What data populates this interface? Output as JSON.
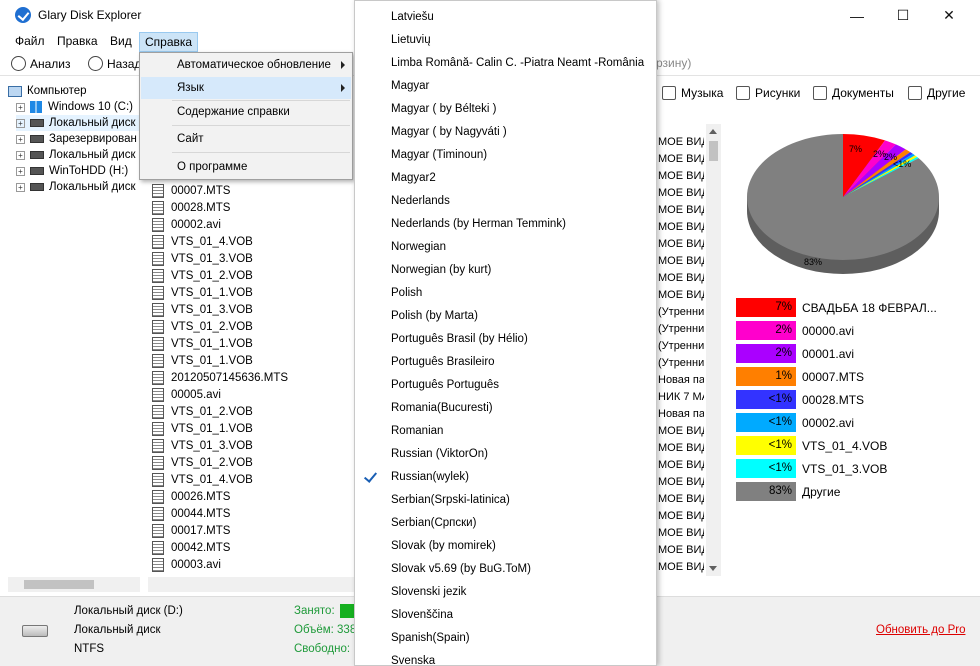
{
  "window": {
    "title": "Glary Disk Explorer",
    "min": "—",
    "max": "☐",
    "close": "✕"
  },
  "menubar": [
    "Файл",
    "Правка",
    "Вид",
    "Справка"
  ],
  "toolbar": {
    "analyze": "Анализ",
    "back": "Назад",
    "recycle_partial": "рзину)"
  },
  "tree": {
    "root": "Компьютер",
    "items": [
      "Windows 10 (C:)",
      "Локальный диск",
      "Зарезервирован",
      "Локальный диск",
      "WinToHDD (H:)",
      "Локальный диск"
    ]
  },
  "files": [
    "00007.MTS",
    "00028.MTS",
    "00002.avi",
    "VTS_01_4.VOB",
    "VTS_01_3.VOB",
    "VTS_01_2.VOB",
    "VTS_01_1.VOB",
    "VTS_01_3.VOB",
    "VTS_01_2.VOB",
    "VTS_01_1.VOB",
    "VTS_01_1.VOB",
    "20120507145636.MTS",
    "00005.avi",
    "VTS_01_2.VOB",
    "VTS_01_1.VOB",
    "VTS_01_3.VOB",
    "VTS_01_2.VOB",
    "VTS_01_4.VOB",
    "00026.MTS",
    "00044.MTS",
    "00017.MTS",
    "00042.MTS",
    "00003.avi"
  ],
  "col2": [
    "МОЕ ВИД",
    "МОЕ ВИД",
    "МОЕ ВИД",
    "МОЕ ВИД",
    "МОЕ ВИД",
    "МОЕ ВИД",
    "МОЕ ВИД",
    "МОЕ ВИД",
    "МОЕ ВИД",
    "МОЕ ВИД",
    "(Утренни",
    "(Утренни",
    "(Утренни",
    "(Утренни",
    "Новая па",
    "НИК 7 МА",
    "Новая па",
    "МОЕ ВИД",
    "МОЕ ВИД",
    "МОЕ ВИД",
    "МОЕ ВИД",
    "МОЕ ВИД",
    "МОЕ ВИД",
    "МОЕ ВИД",
    "МОЕ ВИД",
    "МОЕ ВИД",
    "МОЕ ВИД"
  ],
  "categories": [
    "Музыка",
    "Рисунки",
    "Документы",
    "Другие"
  ],
  "chart_data": {
    "type": "pie",
    "slices": [
      {
        "name": "СВАДЬБА 18 ФЕВРАЛ...",
        "label": "7%",
        "value": 7,
        "color": "#ff0000"
      },
      {
        "name": "00000.avi",
        "label": "2%",
        "value": 2,
        "color": "#ff00cc"
      },
      {
        "name": "00001.avi",
        "label": "2%",
        "value": 2,
        "color": "#aa00ff"
      },
      {
        "name": "00007.MTS",
        "label": "1%",
        "value": 1,
        "color": "#ff7f00"
      },
      {
        "name": "00028.MTS",
        "label": "<1%",
        "value": 0.6,
        "color": "#3333ff"
      },
      {
        "name": "00002.avi",
        "label": "<1%",
        "value": 0.5,
        "color": "#00aaff"
      },
      {
        "name": "VTS_01_4.VOB",
        "label": "<1%",
        "value": 0.5,
        "color": "#ffff00"
      },
      {
        "name": "VTS_01_3.VOB",
        "label": "<1%",
        "value": 0.4,
        "color": "#00ffff"
      },
      {
        "name": "Другие",
        "label": "83%",
        "value": 83,
        "color": "#808080"
      }
    ],
    "pie_labels": [
      "7%",
      "2%",
      "2%",
      "<1%",
      "83%"
    ]
  },
  "help_menu": {
    "items": [
      {
        "label": "Автоматическое обновление",
        "submenu": true
      },
      {
        "label": "Язык",
        "submenu": true
      },
      {
        "label": "Содержание справки",
        "submenu": false
      },
      {
        "label": "Сайт",
        "submenu": false
      },
      {
        "label": "О программе",
        "submenu": false
      }
    ]
  },
  "languages": {
    "checked": "Russian(wylek)",
    "items": [
      "Latviešu",
      "Lietuvių",
      "Limba Română- Calin C. -Piatra Neamt -România",
      "Magyar",
      "Magyar ( by Bélteki )",
      "Magyar ( by Nagyváti )",
      "Magyar (Timinoun)",
      "Magyar2",
      "Nederlands",
      "Nederlands (by Herman Temmink)",
      "Norwegian",
      "Norwegian (by kurt)",
      "Polish",
      "Polish (by Marta)",
      "Português Brasil (by Hélio)",
      "Português Brasileiro",
      "Português Português",
      "Romania(Bucuresti)",
      "Romanian",
      "Russian (ViktorOn)",
      "Russian(wylek)",
      "Serbian(Srpski-latinica)",
      "Serbian(Српски)",
      "Slovak (by momirek)",
      "Slovak v5.69 (by BuG.ToM)",
      "Slovenski jezik",
      "Slovenščina",
      "Spanish(Spain)",
      "Svenska"
    ]
  },
  "status": {
    "drive_name": "Локальный диск (D:)",
    "drive_type": "Локальный диск",
    "fs": "NTFS",
    "used_label": "Занято:",
    "size_label": "Объём: 338",
    "free_label": "Свободно: ",
    "update": "Обновить до Pro"
  }
}
